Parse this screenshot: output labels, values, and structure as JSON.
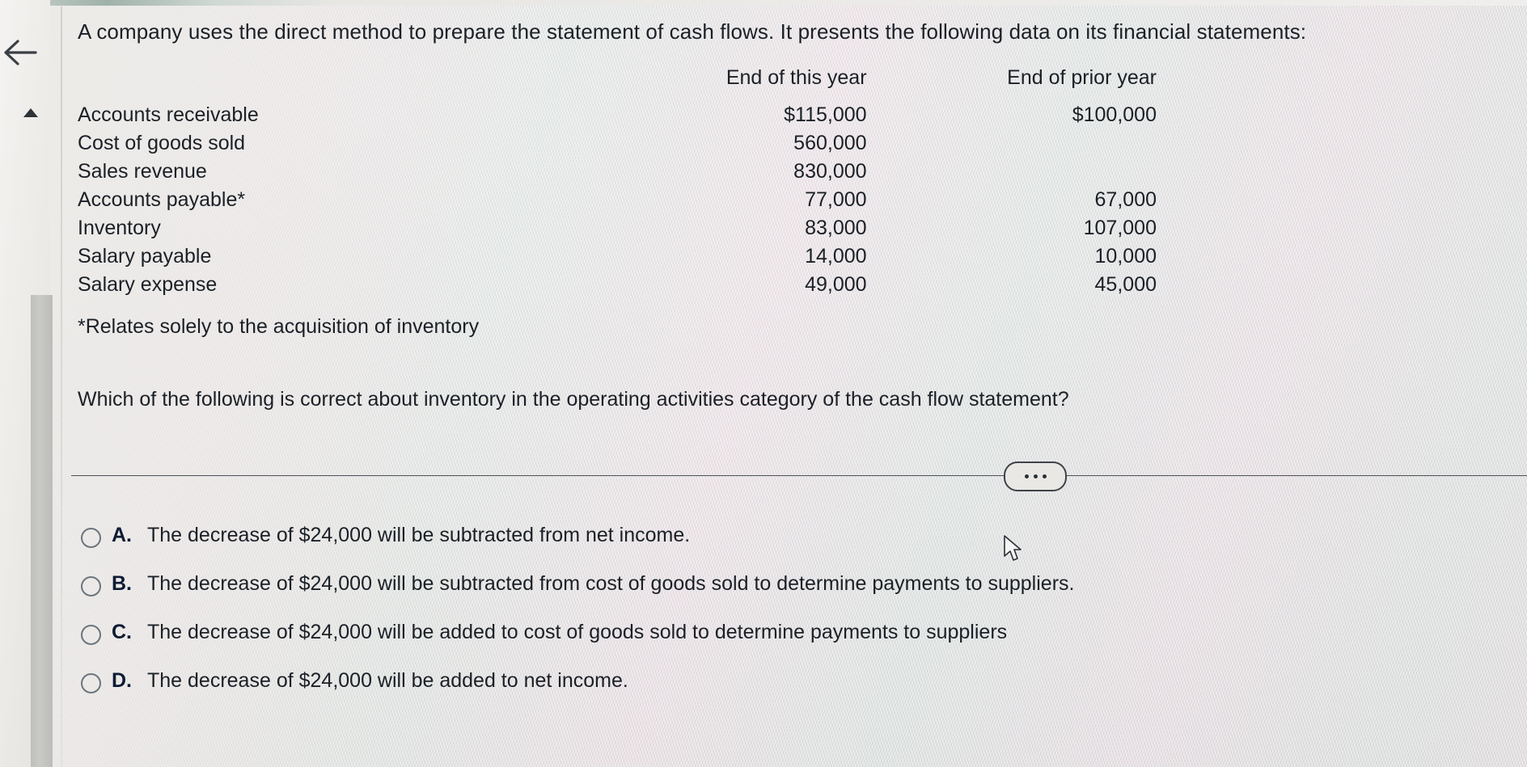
{
  "prompt": "A company uses the direct method to prepare the statement of cash flows. It presents the following data on its financial statements:",
  "table": {
    "headers": [
      "",
      "End of this year",
      "End of prior year"
    ],
    "rows": [
      {
        "label": "Accounts receivable",
        "this_year": "$115,000",
        "prior_year": "$100,000"
      },
      {
        "label": "Cost of goods sold",
        "this_year": "560,000",
        "prior_year": ""
      },
      {
        "label": "Sales revenue",
        "this_year": "830,000",
        "prior_year": ""
      },
      {
        "label": "Accounts payable*",
        "this_year": "77,000",
        "prior_year": "67,000"
      },
      {
        "label": "Inventory",
        "this_year": "83,000",
        "prior_year": "107,000"
      },
      {
        "label": "Salary payable",
        "this_year": "14,000",
        "prior_year": "10,000"
      },
      {
        "label": "Salary expense",
        "this_year": "49,000",
        "prior_year": "45,000"
      }
    ]
  },
  "footnote": "*Relates solely to the acquisition of inventory",
  "question": "Which of the following is correct about inventory in the operating activities category of the cash flow statement?",
  "options": [
    {
      "letter": "A.",
      "text": "The decrease of $24,000 will be subtracted from net income."
    },
    {
      "letter": "B.",
      "text": "The decrease of $24,000 will be subtracted from cost of goods sold to determine payments to suppliers."
    },
    {
      "letter": "C.",
      "text": "The decrease of $24,000 will be added to cost of goods sold to determine payments to suppliers"
    },
    {
      "letter": "D.",
      "text": "The decrease of $24,000 will be added to net income."
    }
  ],
  "nav": {
    "back_icon": "back-arrow-icon",
    "scroll_up_icon": "scroll-up-arrow-icon",
    "more_button_icon": "ellipsis-icon"
  },
  "colors": {
    "background": "#e6e5e3",
    "text": "#1b2026",
    "option_letter": "#0d1b33",
    "radio_border": "#6c757d",
    "divider": "#4c5157",
    "scrollbar_thumb": "#c3c3c0"
  }
}
